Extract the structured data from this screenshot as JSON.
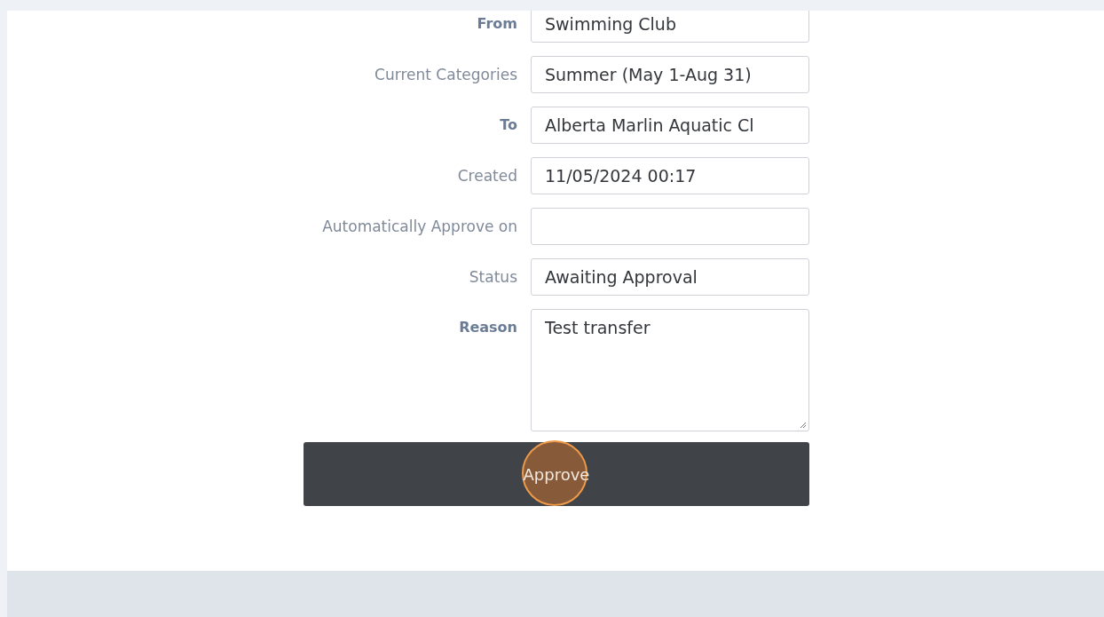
{
  "fields": [
    {
      "label": "From",
      "required": true,
      "value": "Swimming Club"
    },
    {
      "label": "Current Categories",
      "required": false,
      "value": "Summer (May 1-Aug 31)"
    },
    {
      "label": "To",
      "required": true,
      "value": "Alberta Marlin Aquatic Cl"
    },
    {
      "label": "Created",
      "required": false,
      "value": "11/05/2024 00:17"
    },
    {
      "label": "Automatically Approve on",
      "required": false
    },
    {
      "label": "Status",
      "required": false,
      "value": "Awaiting Approval"
    }
  ],
  "reason": {
    "label": "Reason",
    "required": true,
    "value": "Test transfer"
  },
  "approve_button": {
    "label": "Approve",
    "highlighted": true
  }
}
